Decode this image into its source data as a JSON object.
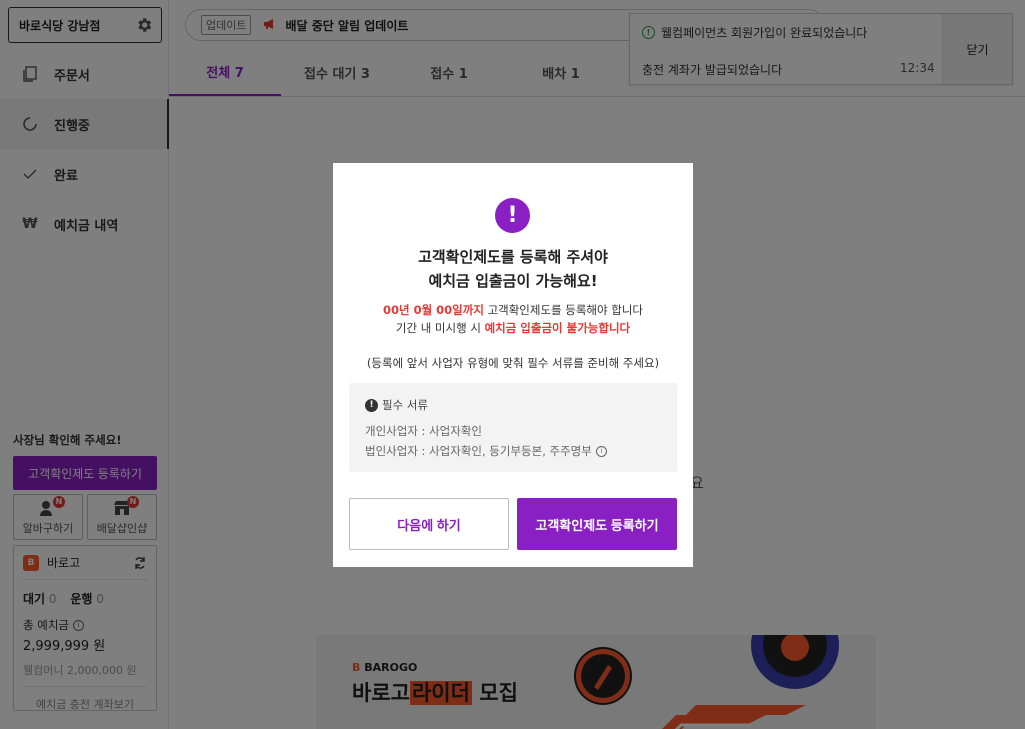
{
  "sidebar": {
    "store_name": "바로식당 강남점",
    "nav": [
      {
        "label": "주문서",
        "icon": "copy-icon"
      },
      {
        "label": "진행중",
        "icon": "progress-icon"
      },
      {
        "label": "완료",
        "icon": "check-icon"
      },
      {
        "label": "예치금 내역",
        "icon": "won-icon"
      }
    ],
    "notice_title": "사장님 확인해 주세요!",
    "verify_button": "고객확인제도 등록하기",
    "mini_buttons": [
      {
        "label": "알바구하기",
        "badge": "N"
      },
      {
        "label": "배달샵인샵",
        "badge": "N"
      }
    ],
    "card": {
      "brand": "바로고",
      "waiting_label": "대기",
      "waiting_count": "0",
      "running_label": "운행",
      "running_count": "0",
      "deposit_label": "총 예치금",
      "deposit_amount": "2,999,999 원",
      "welcome_money": "웰컴머니 2,000,000 원",
      "account_link": "예치금 충전 계좌보기"
    }
  },
  "update_bar": {
    "tag": "업데이트",
    "text": "배달 중단 알림 업데이트"
  },
  "tabs": [
    {
      "label": "전체 7"
    },
    {
      "label": "접수 대기 3"
    },
    {
      "label": "접수 1"
    },
    {
      "label": "배차 1"
    }
  ],
  "empty_fragment": "요",
  "banner": {
    "brand_mark": "B",
    "brand_name": "BAROGO",
    "title_pre": "바로고",
    "title_highlight": "라이더",
    "title_post": "모집"
  },
  "toast": {
    "message1": "웰컴페이먼츠 회원가입이 완료되었습니다",
    "message2": "충전 계좌가 발급되었습니다",
    "time": "12:34",
    "close": "닫기"
  },
  "modal": {
    "icon": "!",
    "title_line1": "고객확인제도를 등록해 주셔야",
    "title_line2": "예치금 입출금이 가능해요!",
    "deadline": "00년 0월 00일까지",
    "deadline_rest": "고객확인제도를 등록해야 합니다",
    "penalty_pre": "기간 내 미시행 시",
    "penalty": "예치금 입출금이 불가능합니다",
    "note": "(등록에 앞서 사업자 유형에 맞춰 필수 서류를 준비해 주세요)",
    "docs_title": "필수 서류",
    "docs_individual": "개인사업자 : 사업자확인",
    "docs_corporate": "법인사업자 : 사업자확인, 등기부등본, 주주명부",
    "later_button": "다음에 하기",
    "register_button": "고객확인제도 등록하기"
  }
}
